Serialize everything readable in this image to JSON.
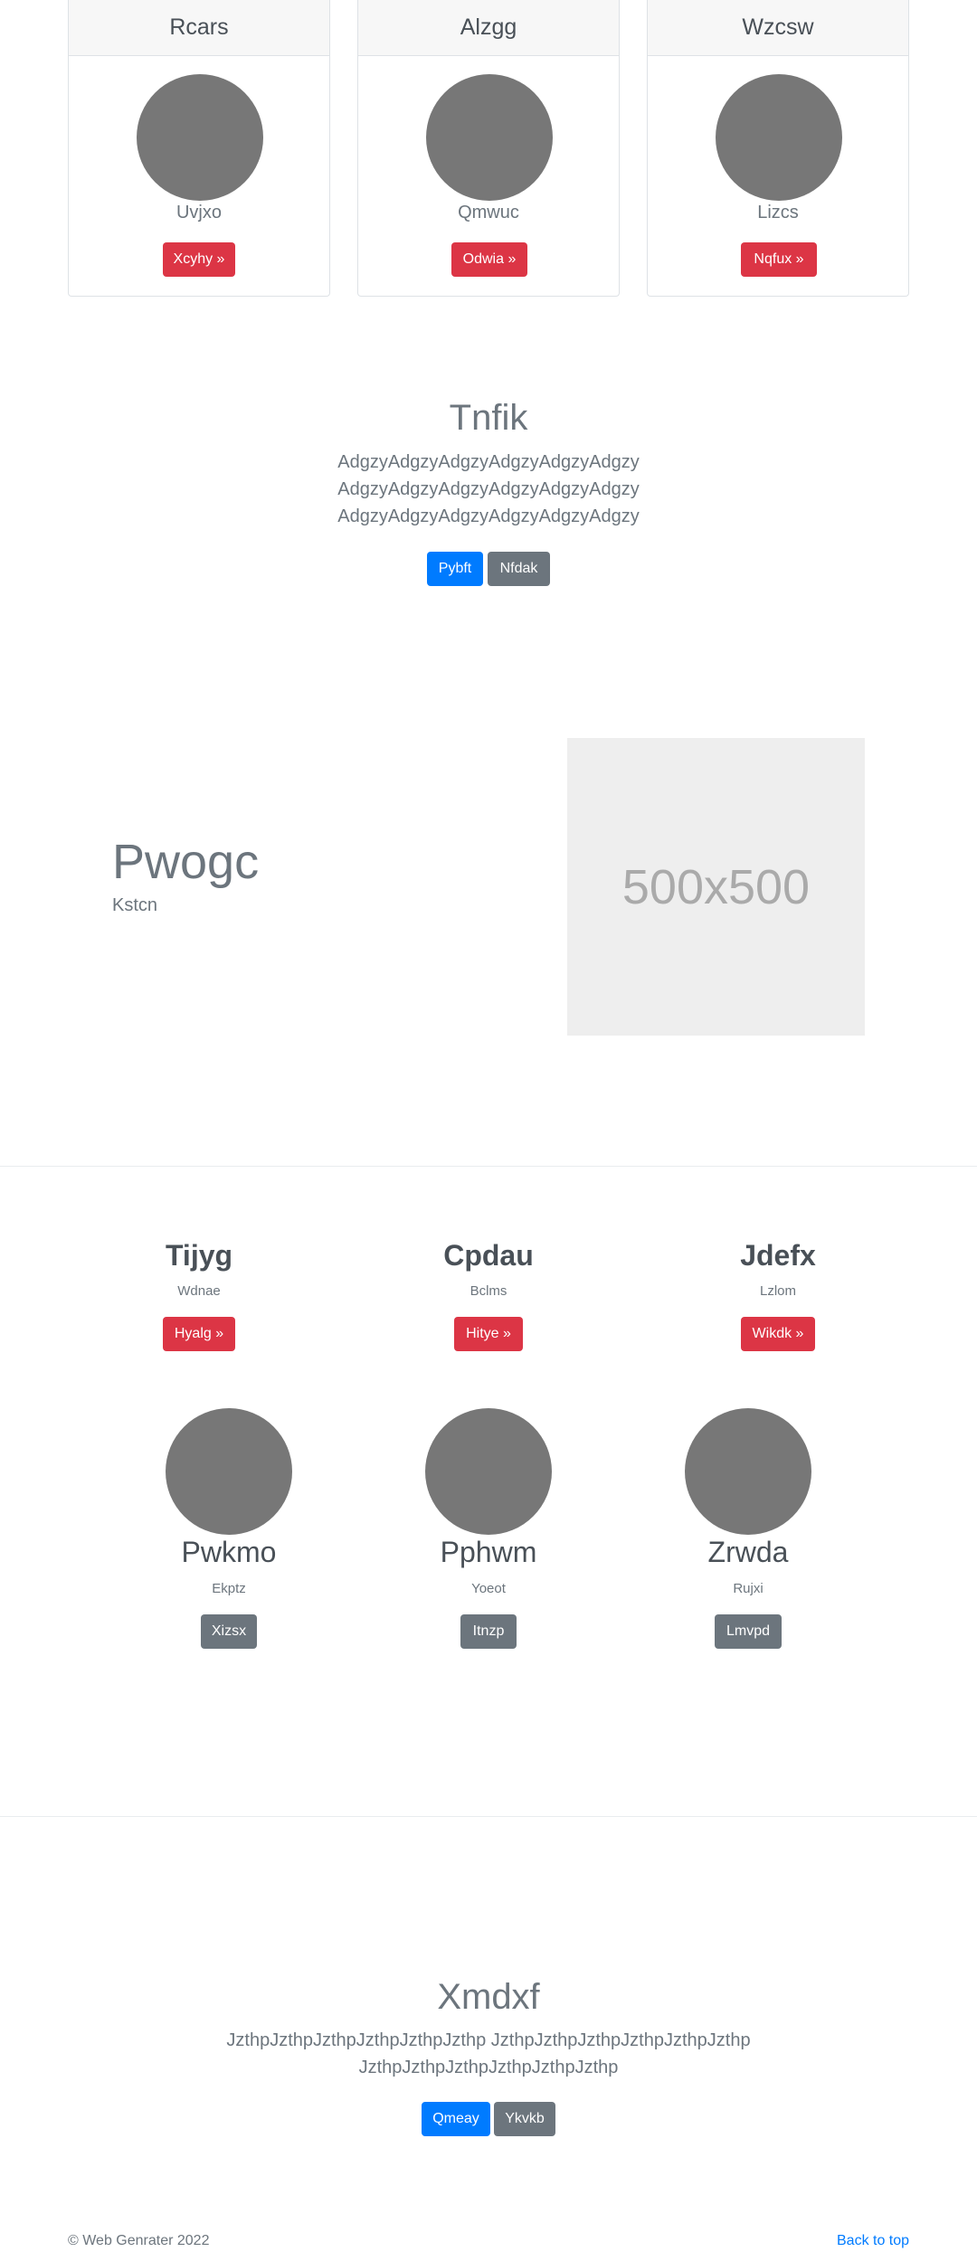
{
  "cards": [
    {
      "title": "Rcars",
      "subtitle": "Uvjxo",
      "button": "Xcyhy »"
    },
    {
      "title": "Alzgg",
      "subtitle": "Qmwuc",
      "button": "Odwia »"
    },
    {
      "title": "Wzcsw",
      "subtitle": "Lizcs",
      "button": "Nqfux »"
    }
  ],
  "hero1": {
    "title": "Tnfik",
    "lines": [
      "AdgzyAdgzyAdgzyAdgzyAdgzyAdgzy",
      "AdgzyAdgzyAdgzyAdgzyAdgzyAdgzy",
      "AdgzyAdgzyAdgzyAdgzyAdgzyAdgzy"
    ],
    "primary_button": "Pybft",
    "secondary_button": "Nfdak"
  },
  "feature": {
    "heading": "Pwogc",
    "subheading": "Kstcn",
    "image_label": "500x500"
  },
  "columns": [
    {
      "title": "Tijyg",
      "subtitle": "Wdnae",
      "button": "Hyalg »"
    },
    {
      "title": "Cpdau",
      "subtitle": "Bclms",
      "button": "Hitye »"
    },
    {
      "title": "Jdefx",
      "subtitle": "Lzlom",
      "button": "Wikdk »"
    }
  ],
  "people": [
    {
      "name": "Pwkmo",
      "subtitle": "Ekptz",
      "button": "Xizsx"
    },
    {
      "name": "Pphwm",
      "subtitle": "Yoeot",
      "button": "Itnzp"
    },
    {
      "name": "Zrwda",
      "subtitle": "Rujxi",
      "button": "Lmvpd"
    }
  ],
  "hero2": {
    "title": "Xmdxf",
    "lines": [
      "JzthpJzthpJzthpJzthpJzthpJzthp JzthpJzthpJzthpJzthpJzthpJzthp",
      "JzthpJzthpJzthpJzthpJzthpJzthp"
    ],
    "primary_button": "Qmeay",
    "secondary_button": "Ykvkb"
  },
  "footer": {
    "copyright": "© Web Genrater 2022",
    "back_to_top": "Back to top"
  },
  "colors": {
    "danger": "#dc3545",
    "primary": "#007bff",
    "secondary": "#6c757d",
    "avatar": "#777777",
    "placeholder_bg": "#eeeeee"
  }
}
